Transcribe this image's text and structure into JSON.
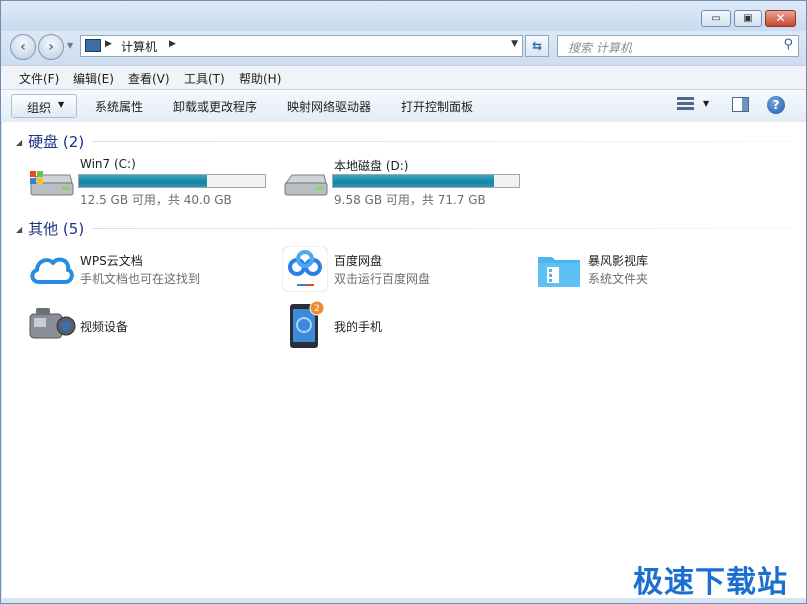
{
  "window": {
    "controls": {
      "minimize": "▭",
      "maximize": "▣",
      "close": "✕"
    }
  },
  "nav": {
    "address_crumb": "计算机",
    "search_placeholder": "搜索 计算机"
  },
  "menu": [
    "文件(F)",
    "编辑(E)",
    "查看(V)",
    "工具(T)",
    "帮助(H)"
  ],
  "toolbar": {
    "organize": "组织",
    "items": [
      "系统属性",
      "卸载或更改程序",
      "映射网络驱动器",
      "打开控制面板"
    ]
  },
  "groups": {
    "hard_disks": {
      "title": "硬盘 (2)"
    },
    "other": {
      "title": "其他 (5)"
    }
  },
  "drives": [
    {
      "name": "Win7 (C:)",
      "free_text": "12.5 GB 可用，共 40.0 GB",
      "used_fraction": 0.6875
    },
    {
      "name": "本地磁盘 (D:)",
      "free_text": "9.58 GB 可用，共 71.7 GB",
      "used_fraction": 0.866
    }
  ],
  "other_items": [
    {
      "title": "WPS云文档",
      "subtitle": "手机文档也可在这找到",
      "icon": "cloud-icon"
    },
    {
      "title": "百度网盘",
      "subtitle": "双击运行百度网盘",
      "icon": "baidu-netdisk-icon"
    },
    {
      "title": "暴风影视库",
      "subtitle": "系统文件夹",
      "icon": "video-folder-icon"
    },
    {
      "title": "视频设备",
      "subtitle": "",
      "icon": "camcorder-icon"
    },
    {
      "title": "我的手机",
      "subtitle": "",
      "icon": "phone-icon",
      "badge": "2"
    }
  ],
  "watermark": "极速下载站",
  "colors": {
    "group_title": "#1e3287",
    "drive_bar": "#17849f",
    "watermark": "#1a6fd0"
  }
}
